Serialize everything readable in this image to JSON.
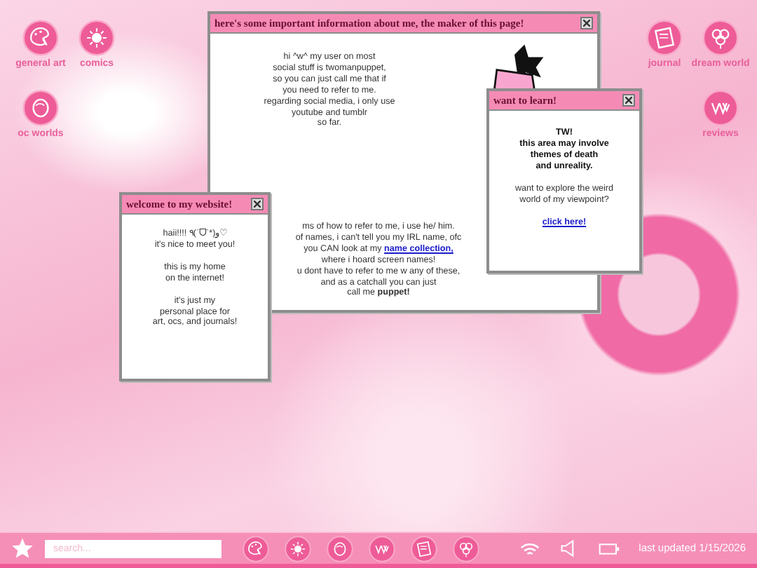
{
  "desktop_icons_left": [
    {
      "label": "general art"
    },
    {
      "label": "comics"
    },
    {
      "label": "oc worlds"
    }
  ],
  "desktop_icons_right": [
    {
      "label": "journal"
    },
    {
      "label": "dream world"
    },
    {
      "label": "reviews"
    }
  ],
  "windows": [
    {
      "kind": "about",
      "title": "here's some important information about me, the maker of this page!",
      "intro_lines": [
        "hi ^w^ my user on most",
        "social stuff is twomanpuppet,",
        "so you can just call me that if",
        "you need to refer to me.",
        "regarding social media, i only use",
        "youtube and tumblr",
        "so far."
      ],
      "lower_lines": [
        {
          "text": "ms of how to refer to me, i use he/ him."
        },
        {
          "text": "of names, i can't tell you my IRL name, ofc"
        },
        {
          "text": "you CAN look at my ",
          "link": "name collection,"
        },
        {
          "text": "where i hoard screen names!"
        },
        {
          "text": "u dont have to refer to me w any of these,"
        },
        {
          "text": "and as a catchall you can just"
        },
        {
          "text": "call me **puppet!**"
        }
      ]
    },
    {
      "kind": "welcome",
      "title": "welcome to my website!",
      "paragraphs": [
        [
          "haii!!!! ٩(ˊᗜˋ*)و♡",
          "it's nice to meet you!"
        ],
        [
          "this is my home",
          "on the internet!"
        ],
        [
          "it's just my",
          "personal place for",
          "art, ocs, and journals!"
        ]
      ]
    },
    {
      "kind": "warning",
      "title": "want to learn!",
      "warning_lines": [
        "TW!",
        "this area may involve",
        "themes of death",
        "and unreality."
      ],
      "question_lines": [
        "want to explore the weird",
        "world of my viewpoint?"
      ],
      "link": "click here!"
    }
  ],
  "taskbar": {
    "search": {
      "placeholder": "search..."
    },
    "status": "last updated 1/15/2026"
  }
}
